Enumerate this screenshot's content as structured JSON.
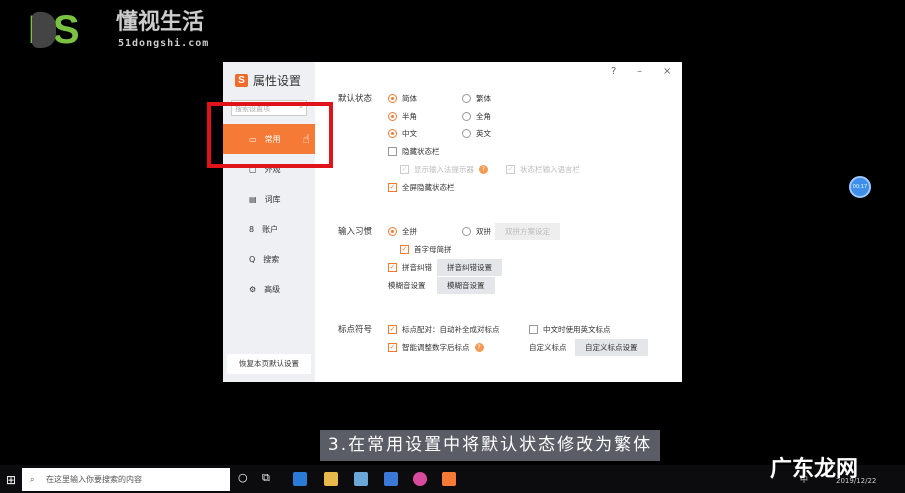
{
  "logo": {
    "mark": "DS",
    "name": "懂视生活",
    "url": "51dongshi.com"
  },
  "dialog": {
    "title": "属性设置",
    "controls": {
      "help": "?",
      "minimize": "–",
      "close": "×"
    },
    "search_placeholder": "搜索设置项",
    "nav": [
      {
        "label": "常用",
        "icon": "monitor-icon"
      },
      {
        "label": "外观",
        "icon": "skin-icon"
      },
      {
        "label": "词库",
        "icon": "book-icon"
      },
      {
        "label": "账户",
        "icon": "user-icon"
      },
      {
        "label": "搜索",
        "icon": "search-icon"
      },
      {
        "label": "高级",
        "icon": "gear-icon"
      }
    ],
    "restore": "恢复本页默认设置",
    "default_state": {
      "label": "默认状态",
      "simplified": "简体",
      "traditional": "繁体",
      "half": "半角",
      "full": "全角",
      "chinese": "中文",
      "english": "英文",
      "hide_bar": "隐藏状态栏",
      "show_tip": "显示输入法提示器",
      "bar_lang": "状态栏输入语言栏",
      "fullscreen_hide": "全屏隐藏状态栏"
    },
    "input": {
      "label": "输入习惯",
      "quanpin": "全拼",
      "shuangpin": "双拼",
      "shuangpin_btn": "双拼方案设定",
      "initial": "首字母简拼",
      "correction": "拼音纠错",
      "correction_btn": "拼音纠错设置",
      "fuzzy": "模糊音设置",
      "fuzzy_btn": "模糊音设置"
    },
    "punct": {
      "label": "标点符号",
      "pair": "标点配对：自动补全成对标点",
      "english_punct": "中文时使用英文标点",
      "smart": "智能调整数字后标点",
      "custom": "自定义标点",
      "custom_btn": "自定义标点设置"
    }
  },
  "bubble": "00:17",
  "subtitle": "3.在常用设置中将默认状态修改为繁体",
  "taskbar": {
    "search_placeholder": "在这里输入你要搜索的内容",
    "ime": "中",
    "date": "2019/12/22"
  },
  "watermark": "广东龙网",
  "colors": {
    "accent": "#f47a35",
    "highlight": "#e0121a"
  }
}
